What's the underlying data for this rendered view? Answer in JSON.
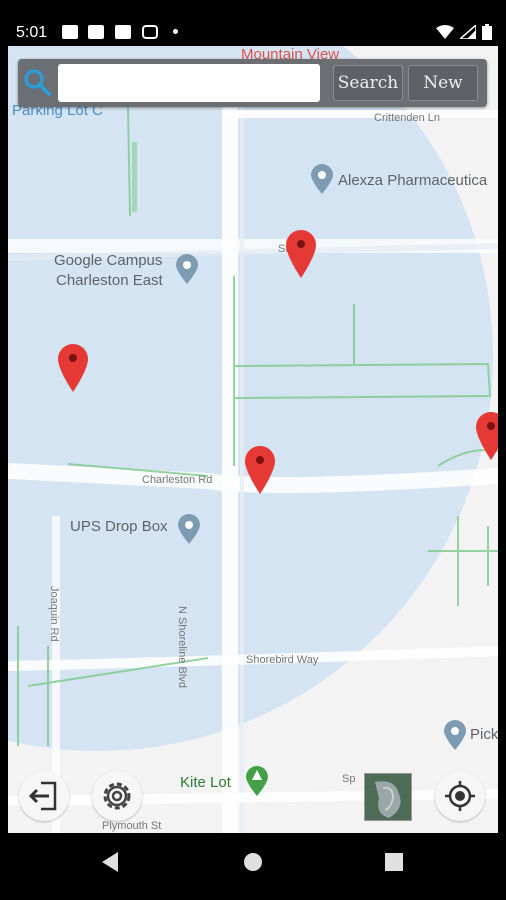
{
  "status_bar": {
    "time": "5:01"
  },
  "search": {
    "placeholder": "",
    "value": "",
    "search_label": "Search",
    "new_label": "New"
  },
  "map_labels": {
    "mountain_view": "Mountain View",
    "parking_lot": "Parking Lot C",
    "crittenden": "Crittenden Ln",
    "alexza": "Alexza Pharmaceutica",
    "google_campus_1": "Google Campus",
    "google_campus_2": "Charleston East",
    "st_ct": "St    Ct",
    "charleston_rd": "Charleston Rd",
    "ups": "UPS Drop Box",
    "shoreline": "N Shoreline Blvd",
    "joaquin": "Joaquin Rd",
    "shorebird": "Shorebird Way",
    "kite_lot": "Kite Lot",
    "pick": "Pick",
    "sp": "Sp",
    "plymouth": "Plymouth St"
  },
  "icons": [
    "search-icon",
    "exit-icon",
    "gear-icon",
    "my-location-icon",
    "satellite-layer-icon",
    "map-marker-icon",
    "place-pin-icon",
    "back-icon",
    "home-icon",
    "recents-icon"
  ],
  "colors": {
    "marker": "#e53935",
    "radius_fill": "#cfe0f1",
    "toolbar": "#6b6f73"
  }
}
